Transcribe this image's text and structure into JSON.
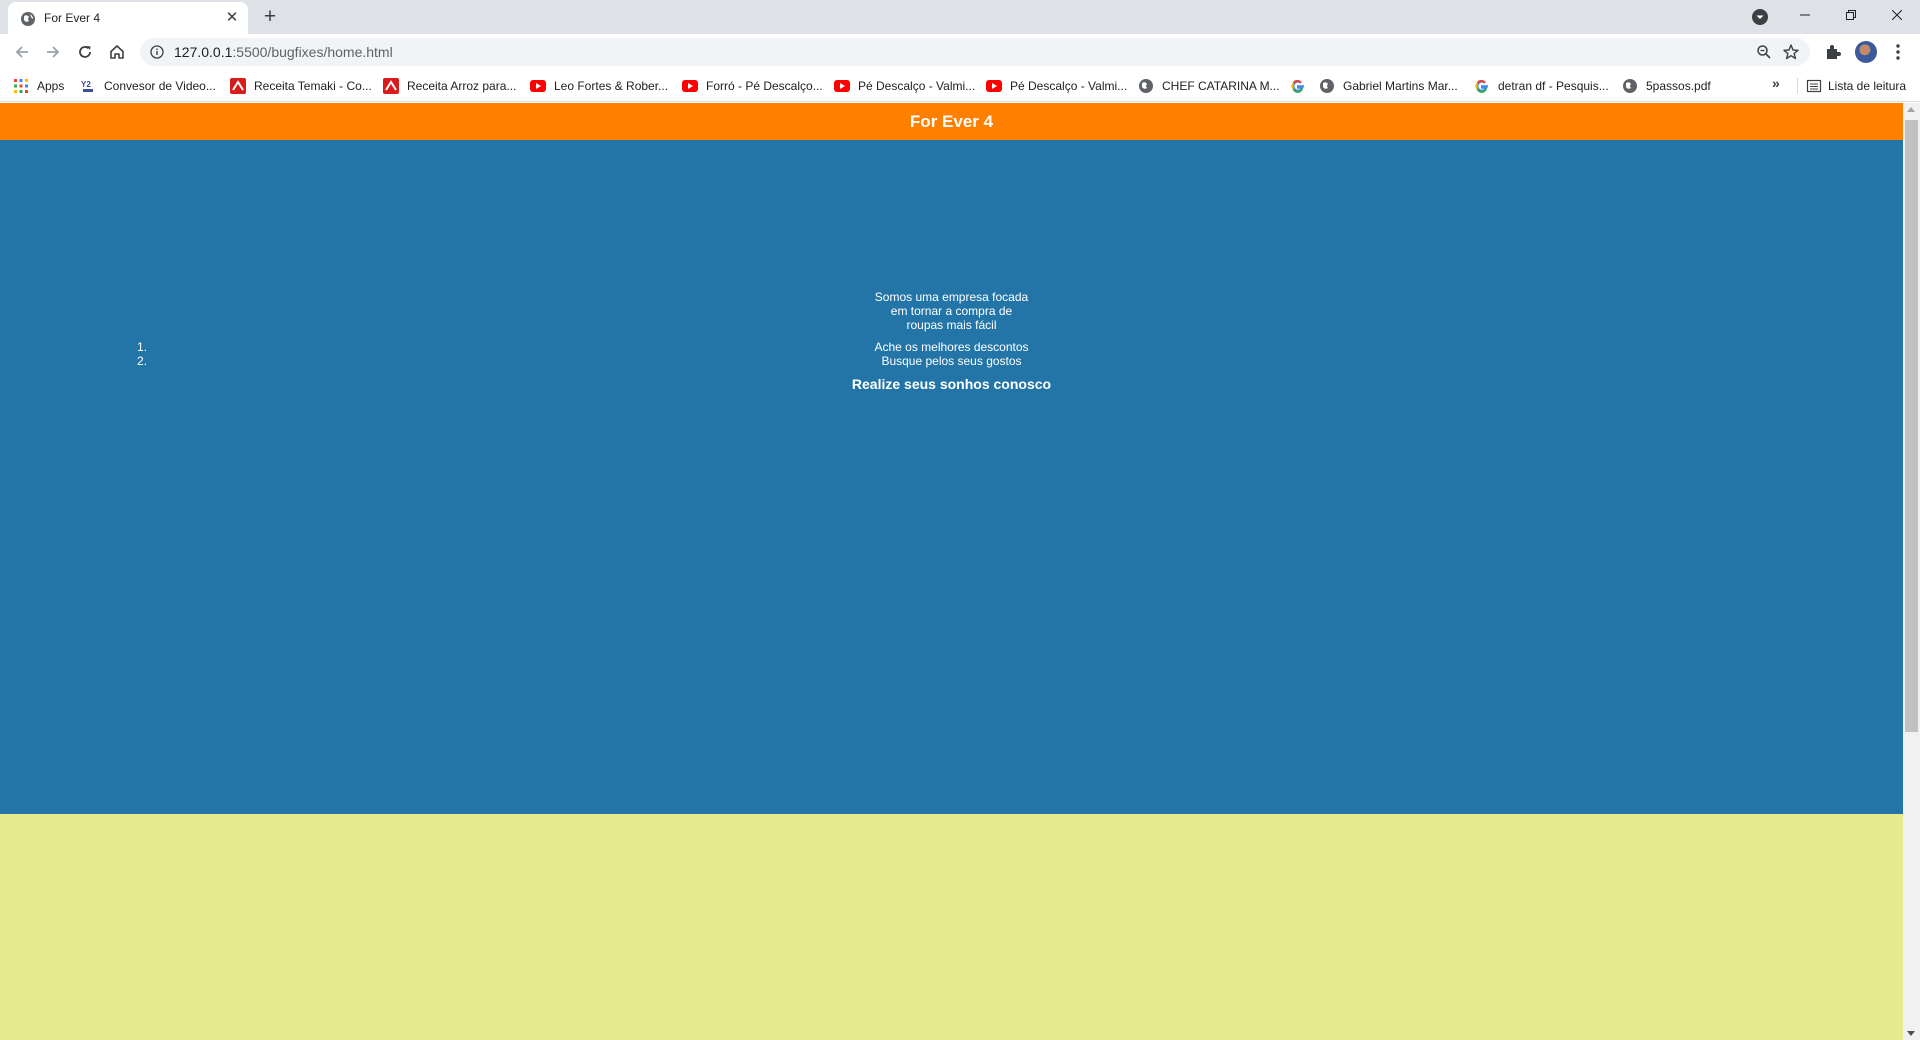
{
  "browser": {
    "tab_title": "For Ever 4",
    "tab_close_glyph": "✕",
    "new_tab_glyph": "+",
    "url_host": "127.0.0.1",
    "url_path": ":5500/bugfixes/home.html",
    "bookmarks": [
      {
        "label": "Apps",
        "icon": "apps-grid-icon"
      },
      {
        "label": "Convesor de Video...",
        "icon": "yt-converter-icon"
      },
      {
        "label": "Receita Temaki - Co...",
        "icon": "recipe-site-icon"
      },
      {
        "label": "Receita Arroz para...",
        "icon": "recipe-site-icon"
      },
      {
        "label": "Leo Fortes & Rober...",
        "icon": "youtube-icon"
      },
      {
        "label": "Forró - Pé Descalço...",
        "icon": "youtube-icon"
      },
      {
        "label": "Pé Descalço - Valmi...",
        "icon": "youtube-icon"
      },
      {
        "label": "Pé Descalço - Valmi...",
        "icon": "youtube-icon"
      },
      {
        "label": "CHEF CATARINA M...",
        "icon": "globe-icon"
      },
      {
        "label": "",
        "icon": "google-icon"
      },
      {
        "label": "Gabriel Martins Mar...",
        "icon": "globe-icon"
      },
      {
        "label": "detran df - Pesquis...",
        "icon": "google-icon"
      },
      {
        "label": "5passos.pdf",
        "icon": "globe-icon"
      }
    ],
    "more_bookmarks_glyph": "»",
    "reading_list_label": "Lista de leitura"
  },
  "page": {
    "header_title": "For Ever 4",
    "ol_markers": [
      "1.",
      "2."
    ],
    "intro_lines": [
      "Somos uma empresa focada",
      "em tornar a compra de",
      "roupas mais fácil"
    ],
    "features": [
      "Ache os melhores descontos",
      "Busque pelos seus gostos"
    ],
    "slogan": "Realize seus sonhos conosco"
  },
  "colors": {
    "header_bg": "#ff8000",
    "hero_bg": "#2375a7",
    "bottom_band_bg": "#e8ea90",
    "youtube_red": "#ff0000",
    "recipe_red": "#d81b1b"
  }
}
